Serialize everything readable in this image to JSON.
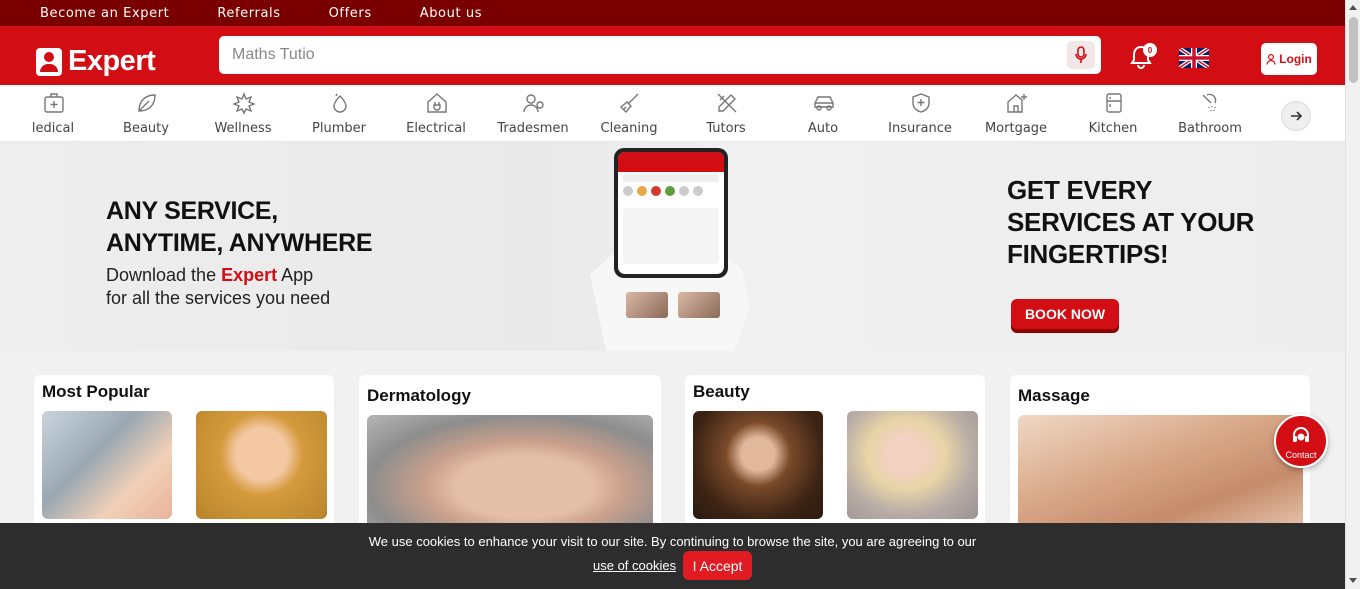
{
  "topbar": {
    "links": [
      "Become an Expert",
      "Referrals",
      "Offers",
      "About us"
    ]
  },
  "header": {
    "logo_text": "Expert",
    "search_value": "Maths Tutio",
    "notification_count": "0",
    "login_label": "Login"
  },
  "categories": [
    "ledical",
    "Beauty",
    "Wellness",
    "Plumber",
    "Electrical",
    "Tradesmen",
    "Cleaning",
    "Tutors",
    "Auto",
    "Insurance",
    "Mortgage",
    "Kitchen",
    "Bathroom"
  ],
  "banner": {
    "headline_1": "ANY SERVICE,",
    "headline_2": "ANYTIME, ANYWHERE",
    "sub_1_pre": "Download the ",
    "sub_1_brand": "Expert",
    "sub_1_post": " App",
    "sub_2": "for all the services you need",
    "right_1": "GET EVERY",
    "right_2": "SERVICES AT YOUR",
    "right_3": "FINGERTIPS!",
    "cta": "BOOK NOW"
  },
  "sections": [
    {
      "title": "Most Popular"
    },
    {
      "title": "Dermatology"
    },
    {
      "title": "Beauty"
    },
    {
      "title": "Massage"
    }
  ],
  "contact": {
    "label": "Contact"
  },
  "cookie": {
    "message": "We use cookies to enhance your visit to our site. By continuing to browse the site, you are agreeing to our",
    "link": "use of cookies",
    "accept": "I Accept"
  },
  "colors": {
    "brand_red": "#d20d14",
    "topbar": "#7a0000",
    "cookie_bg": "#2d2d2d"
  }
}
